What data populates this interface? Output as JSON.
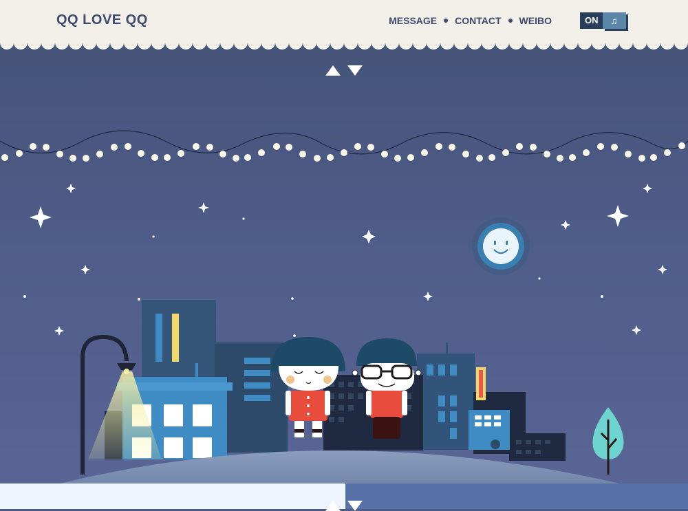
{
  "header": {
    "logo": "QQ LOVE QQ",
    "nav": [
      {
        "label": "MESSAGE"
      },
      {
        "label": "CONTACT"
      },
      {
        "label": "WEIBO"
      }
    ],
    "music_toggle": {
      "state_label": "ON",
      "icon": "music-note-icon"
    }
  },
  "colors": {
    "header_bg": "#f3efe9",
    "sky": "#4e5c88",
    "text": "#3d4a6b",
    "ground": "#8ea2c2"
  },
  "navigation_arrows": {
    "up_icon": "arrow-up-icon",
    "down_icon": "arrow-down-icon"
  }
}
